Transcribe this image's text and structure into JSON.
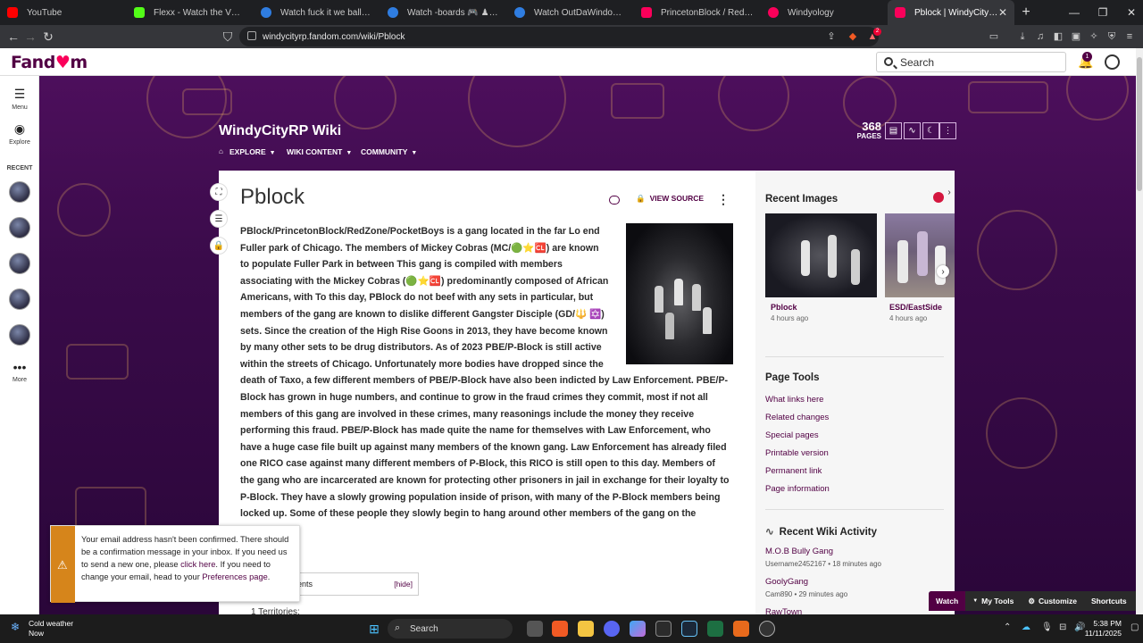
{
  "browser": {
    "tabs": [
      {
        "label": "YouTube",
        "color": "#ff0000"
      },
      {
        "label": "Flexx - Watch the VOD on K",
        "color": "#53fc18"
      },
      {
        "label": "Watch fuck it we ball-glock | St",
        "color": "#2f7de1"
      },
      {
        "label": "Watch -boards 🎮 ♟ | Stream",
        "color": "#2f7de1"
      },
      {
        "label": "Watch OutDaWindow 🍭 -gaza",
        "color": "#2f7de1"
      },
      {
        "label": "PrincetonBlock / Redzone 🟢",
        "color": "#fa005a"
      },
      {
        "label": "Windyology",
        "color": "#fa005a"
      },
      {
        "label": "Pblock | WindyCityRP Wiki",
        "color": "#fa005a"
      }
    ],
    "url": "windycityrp.fandom.com/wiki/Pblock",
    "brave_badge": "2"
  },
  "fandom": {
    "logo_prefix": "Fand",
    "logo_heart": "♥",
    "logo_suffix": "m",
    "search_label": "Search",
    "notif_count": "1"
  },
  "rail": {
    "menu": "Menu",
    "explore": "Explore",
    "recent": "RECENT",
    "more": "More"
  },
  "wiki": {
    "title": "WindyCityRP Wiki",
    "nav": [
      "EXPLORE",
      "WIKI CONTENT",
      "COMMUNITY"
    ],
    "pages_count": "368",
    "pages_label": "PAGES"
  },
  "article": {
    "title": "Pblock",
    "view_source": "VIEW SOURCE",
    "body": "PBlock/PrincetonBlock/RedZone/PocketBoys is a gang located in the far Lo end Fuller park of Chicago. The members of Mickey Cobras (MC/🟢⭐🆑) are known to populate Fuller Park in between This gang is compiled with members associating with the Mickey Cobras (🟢⭐🆑) predominantly composed of African Americans, with To this day, PBlock do not beef with any sets in particular, but members of the gang are known to dislike different Gangster Disciple (GD/🔱 ✡️) sets. Since the creation of the High Rise Goons in 2013, they have become known by many other sets to be drug distributors. As of 2023 PBE/P-Block is still active within the streets of Chicago. Unfortunately more bodies have dropped since the death of Taxo, a few different members of PBE/P-Block have also been indicted by Law Enforcement. PBE/P-Block has grown in huge numbers, and continue to grow in the fraud crimes they commit, most if not all members of this gang are involved in these crimes, many reasonings include the money they receive performing this fraud. PBE/P-Block has made quite the name for themselves with Law Enforcement, who have a huge case file built up against many members of the known gang. Law Enforcement has already filed one RICO case against many different members of P-Block, this RICO is still open to this day. Members of the gang who are incarcerated are known for protecting other prisoners in jail in exchange for their loyalty to P-Block. They have a slowly growing population inside of prison, with many of the P-Block members being locked up. Some of these people they slowly begin to hang around other members of the gang on the outside.",
    "toc_title": "Contents",
    "toc_hide": "[hide]",
    "toc_first": "1   Territories:"
  },
  "rightrail": {
    "recent_images_title": "Recent Images",
    "images": [
      {
        "caption": "Pblock",
        "time": "4 hours ago"
      },
      {
        "caption": "ESD/EastSide",
        "time": "4 hours ago"
      }
    ],
    "page_tools_title": "Page Tools",
    "page_tools": [
      "What links here",
      "Related changes",
      "Special pages",
      "Printable version",
      "Permanent link",
      "Page information"
    ],
    "activity_title": "Recent Wiki Activity",
    "activity": [
      {
        "title": "M.O.B Bully Gang",
        "meta": "Username2452167 • 18 minutes ago"
      },
      {
        "title": "GoolyGang",
        "meta": "Cam890 • 29 minutes ago"
      },
      {
        "title": "RawTown",
        "meta": ""
      }
    ]
  },
  "toast": {
    "text_before": "Your email address hasn't been confirmed. There should be a confirmation message in your inbox. If you need us to send a new one, please ",
    "link1": "click here",
    "text_middle": ". If you need to change your email, head to your ",
    "link2": "Preferences page",
    "text_after": "."
  },
  "toolbar": {
    "watch": "Watch",
    "my_tools": "My Tools",
    "customize": "Customize",
    "shortcuts": "Shortcuts"
  },
  "taskbar": {
    "weather_title": "Cold weather",
    "weather_sub": "Now",
    "search": "Search",
    "time": "5:38 PM",
    "date": "11/11/2025"
  }
}
